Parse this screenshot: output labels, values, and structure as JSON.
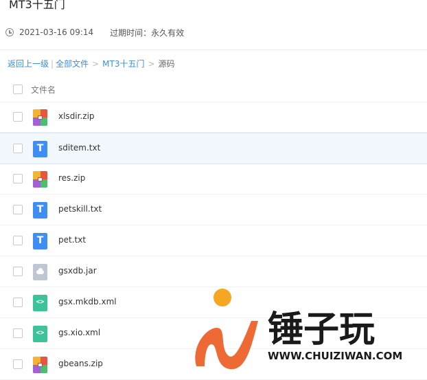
{
  "page": {
    "title": "MT3十五门",
    "created_at": "2021-03-16 09:14",
    "expire_label": "过期时间：",
    "expire_value": "永久有效"
  },
  "breadcrumb": {
    "back": "返回上一级",
    "pipe": "|",
    "all_files": "全部文件",
    "sep": ">",
    "folder": "MT3十五门",
    "current": "源码"
  },
  "table": {
    "column_header": "文件名",
    "rows": [
      {
        "name": "xlsdir.zip",
        "icon": "zip-file-icon"
      },
      {
        "name": "sditem.txt",
        "icon": "txt-file-icon"
      },
      {
        "name": "res.zip",
        "icon": "zip-file-icon"
      },
      {
        "name": "petskill.txt",
        "icon": "txt-file-icon"
      },
      {
        "name": "pet.txt",
        "icon": "txt-file-icon"
      },
      {
        "name": "gsxdb.jar",
        "icon": "jar-file-icon"
      },
      {
        "name": "gsx.mkdb.xml",
        "icon": "xml-file-icon"
      },
      {
        "name": "gs.xio.xml",
        "icon": "xml-file-icon"
      },
      {
        "name": "gbeans.zip",
        "icon": "zip-file-icon"
      }
    ]
  },
  "watermark": {
    "text_cn": "锤子玩",
    "text_en": "WWW.CHUIZIWAN.COM",
    "colors": {
      "orange": "#ee6a34",
      "yellow": "#f5a623",
      "teal": "#1aa89a",
      "black": "#1a1a1a"
    }
  },
  "colors": {
    "link": "#3b8ed8",
    "highlight_row": "#f2f8fd",
    "txt_icon": "#3f8ef4",
    "xml_icon": "#3cc39a",
    "jar_icon": "#bfc7d2"
  }
}
